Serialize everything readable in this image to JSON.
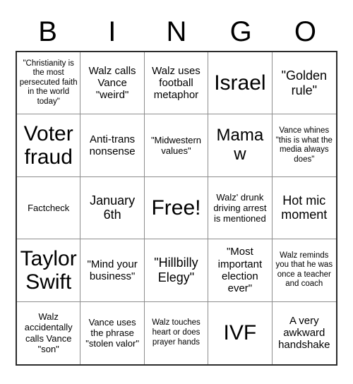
{
  "header": {
    "letters": [
      "B",
      "I",
      "N",
      "G",
      "O"
    ]
  },
  "grid": {
    "columns": 5,
    "rows": 5,
    "free_space_label": "Free!",
    "free_space_position": {
      "row": 3,
      "column": 3
    },
    "cells": [
      [
        {
          "text": "\"Christianity is the most persecuted faith in the world today\"",
          "size": "xs"
        },
        {
          "text": "Walz calls Vance \"weird\"",
          "size": "m"
        },
        {
          "text": "Walz uses football metaphor",
          "size": "m"
        },
        {
          "text": "Israel",
          "size": "xxl"
        },
        {
          "text": "\"Golden rule\"",
          "size": "l"
        }
      ],
      [
        {
          "text": "Voter fraud",
          "size": "xxl"
        },
        {
          "text": "Anti-trans nonsense",
          "size": "m"
        },
        {
          "text": "\"Midwestern values\"",
          "size": "s"
        },
        {
          "text": "Mamaw",
          "size": "xl"
        },
        {
          "text": "Vance whines \"this is what the media always does\"",
          "size": "xs"
        }
      ],
      [
        {
          "text": "Factcheck",
          "size": "s"
        },
        {
          "text": "January 6th",
          "size": "l"
        },
        {
          "text": "Free!",
          "size": "xxl"
        },
        {
          "text": "Walz' drunk driving arrest is mentioned",
          "size": "s"
        },
        {
          "text": "Hot mic moment",
          "size": "l"
        }
      ],
      [
        {
          "text": "Taylor Swift",
          "size": "xxl"
        },
        {
          "text": "\"Mind your business\"",
          "size": "m"
        },
        {
          "text": "\"Hillbilly Elegy\"",
          "size": "l"
        },
        {
          "text": "\"Most important election ever\"",
          "size": "m"
        },
        {
          "text": "Walz reminds you that he was once a teacher and coach",
          "size": "xs"
        }
      ],
      [
        {
          "text": "Walz accidentally calls Vance \"son\"",
          "size": "s"
        },
        {
          "text": "Vance uses the phrase \"stolen valor\"",
          "size": "s"
        },
        {
          "text": "Walz touches heart or does prayer hands",
          "size": "xs"
        },
        {
          "text": "IVF",
          "size": "xxl"
        },
        {
          "text": "A very awkward handshake",
          "size": "m"
        }
      ]
    ]
  },
  "colors": {
    "background": "#ffffff",
    "text": "#000000",
    "outer_border": "#2b2b2b",
    "inner_border": "#8d8d8d"
  }
}
